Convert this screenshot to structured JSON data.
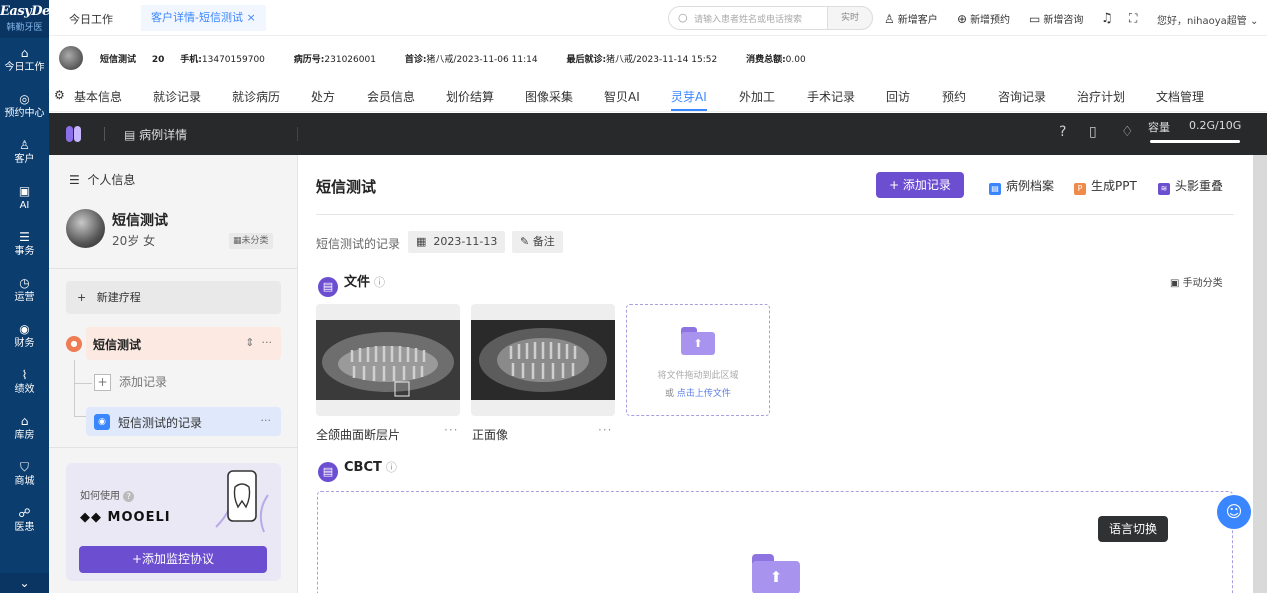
{
  "brand": {
    "name": "EasyDent",
    "sub": "韩勤牙医"
  },
  "leftnav": [
    {
      "icon": "⌂",
      "label": "今日工作"
    },
    {
      "icon": "◎",
      "label": "预约中心"
    },
    {
      "icon": "♙",
      "label": "客户"
    },
    {
      "icon": "▣",
      "label": "AI"
    },
    {
      "icon": "☰",
      "label": "事务"
    },
    {
      "icon": "◷",
      "label": "运营"
    },
    {
      "icon": "◉",
      "label": "财务"
    },
    {
      "icon": "⌇",
      "label": "绩效"
    },
    {
      "icon": "⌂",
      "label": "库房"
    },
    {
      "icon": "⛉",
      "label": "商城"
    },
    {
      "icon": "☍",
      "label": "医患"
    }
  ],
  "topbar": {
    "tab_today": "今日工作",
    "tab_active": "客户详情-短信测试 ×",
    "search_placeholder": "请输入患者姓名或电话搜索",
    "search_mode": "实时",
    "actions": [
      "新增客户",
      "新增预约",
      "新增咨询"
    ],
    "greeting": "您好，nihaoya超管"
  },
  "patient": {
    "name": "短信测试",
    "age": "20",
    "phone_label": "手机:",
    "phone": "13470159700",
    "record_label": "病历号:",
    "record": "231026001",
    "first_label": "首诊:",
    "first": "猪八戒/2023-11-06 11:14",
    "last_label": "最后就诊:",
    "last": "猪八戒/2023-11-14 15:52",
    "spend_label": "消费总额:",
    "spend": "0.00"
  },
  "subtabs": [
    "基本信息",
    "就诊记录",
    "就诊病历",
    "处方",
    "会员信息",
    "划价结算",
    "图像采集",
    "智贝AI",
    "灵芽AI",
    "外加工",
    "手术记录",
    "回访",
    "预约",
    "咨询记录",
    "治疗计划",
    "文档管理"
  ],
  "active_subtab": "灵芽AI",
  "darkbar": {
    "title": "病例详情",
    "capacity_label": "容量",
    "capacity_value": "0.2G/10G"
  },
  "left_panel": {
    "section_title": "个人信息",
    "name": "短信测试",
    "age_sex": "20岁   女",
    "category": "未分类",
    "new_course": "新建疗程",
    "case_name": "短信测试",
    "add_record": "添加记录",
    "record_name": "短信测试的记录",
    "how_to_use": "如何使用",
    "brand": "MOOELI",
    "add_protocol": "+添加监控协议"
  },
  "main": {
    "title": "短信测试",
    "add_record_btn": "+ 添加记录",
    "btn_archive": "病例档案",
    "btn_ppt": "生成PPT",
    "btn_ceph": "头影重叠",
    "record_label": "短信测试的记录",
    "date": "2023-11-13",
    "note": "备注",
    "files_title": "文件",
    "manual_classify": "手动分类",
    "thumbs": [
      {
        "caption": "全颌曲面断层片"
      },
      {
        "caption": "正面像"
      }
    ],
    "upload_hint": "将文件拖动到此区域",
    "upload_or": "或 ",
    "upload_link": "点击上传文件",
    "cbct_title": "CBCT"
  },
  "tooltip": "语言切换",
  "colors": {
    "accent": "#6c4ed1",
    "primary": "#3a86ff",
    "nav": "#0b3d6e"
  }
}
